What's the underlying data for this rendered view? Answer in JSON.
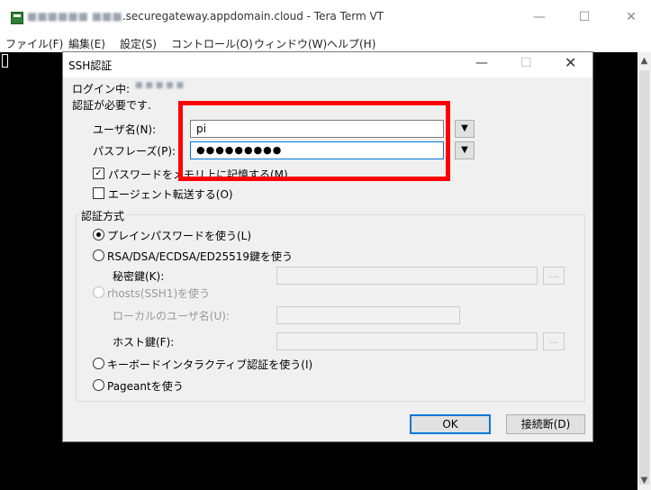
{
  "window": {
    "title_blurred": "■■■■■■ ■■■",
    "title": ".securegateway.appdomain.cloud - Tera Term VT",
    "controls": {
      "minimize": "—",
      "maximize": "☐",
      "close": "✕"
    }
  },
  "menu": [
    "ファイル(F)",
    "編集(E)",
    "設定(S)",
    "コントロール(O)",
    "ウィンドウ(W)",
    "ヘルプ(H)"
  ],
  "dialog": {
    "title": "SSH認証",
    "controls": {
      "minimize": "—",
      "maximize": "☐",
      "close": "✕"
    },
    "logging_in_label": "ログイン中:",
    "logging_in_host": "■ ■ ■ ■ ■",
    "auth_required": "認証が必要です.",
    "username_label": "ユーザ名(N):",
    "username_value": "pi",
    "passphrase_label": "パスフレーズ(P):",
    "passphrase_value": "●●●●●●●●●",
    "remember_password": "パスワードをメモリ上に記憶する(M)",
    "agent_forwarding": "エージェント転送する(O)",
    "auth_method_label": "認証方式",
    "plain_password": "プレインパスワードを使う(L)",
    "rsa_key": "RSA/DSA/ECDSA/ED25519鍵を使う",
    "private_key_label": "秘密鍵(K):",
    "rhosts": "rhosts(SSH1)を使う",
    "local_username_label": "ローカルのユーザ名(U):",
    "host_key_label": "ホスト鍵(F):",
    "keyboard_interactive": "キーボードインタラクティブ認証を使う(I)",
    "pageant": "Pageantを使う",
    "browse": "...",
    "ok": "OK",
    "disconnect": "接続断(D)"
  },
  "colors": {
    "highlight": "#ff0000",
    "terminal_bg": "#000000",
    "dialog_bg": "#f0f0f0",
    "default_button_border": "#0078d7"
  }
}
